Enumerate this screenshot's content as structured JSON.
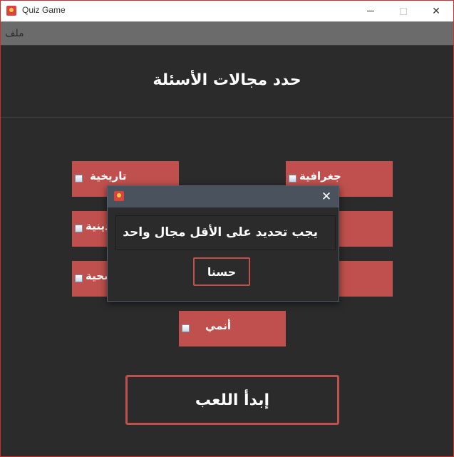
{
  "window": {
    "title": "Quiz Game"
  },
  "menu": {
    "file": "ملف"
  },
  "header": {
    "title": "حدد مجالات الأسئلة"
  },
  "categories": {
    "geography": "جغرافية",
    "history": "تاريخية",
    "religious": "دينية",
    "health": "صحية",
    "anime": "أنمي"
  },
  "play_button": "إبدأ اللعب",
  "dialog": {
    "message": "يجب تحديد على الأقل مجال واحد",
    "ok": "حسنا"
  },
  "colors": {
    "accent": "#c0504d",
    "background": "#2b2b2b",
    "menubar": "#6b6b6b",
    "dialog_titlebar": "#4a525e"
  }
}
